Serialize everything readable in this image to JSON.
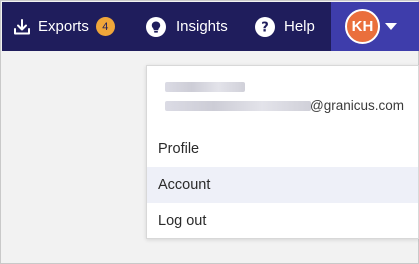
{
  "nav": {
    "exports": {
      "label": "Exports",
      "badge": "4",
      "icon": "download-icon"
    },
    "insights": {
      "label": "Insights",
      "icon": "lightbulb-icon"
    },
    "help": {
      "label": "Help",
      "icon": "help-circle-icon"
    }
  },
  "user": {
    "initials": "KH",
    "email_domain": "@granicus.com"
  },
  "menu": {
    "items": [
      {
        "label": "Profile"
      },
      {
        "label": "Account"
      },
      {
        "label": "Log out"
      }
    ]
  },
  "colors": {
    "topbar": "#1f1d5c",
    "user_area": "#3e3dab",
    "avatar": "#ea6f3c",
    "badge": "#f0a63a",
    "hover_item": "#eef0f8"
  }
}
